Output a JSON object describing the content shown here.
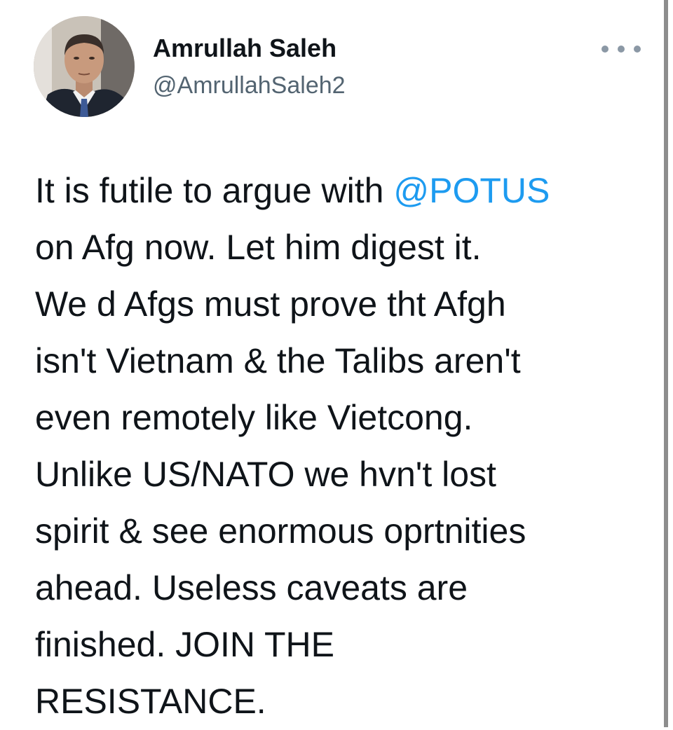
{
  "author": {
    "name": "Amrullah Saleh",
    "handle": "@AmrullahSaleh2",
    "avatar_icon": "profile-photo"
  },
  "menu": {
    "icon": "more-horizontal-icon"
  },
  "tweet": {
    "line1_text": "It is futile to argue with ",
    "mention": "@POTUS",
    "lines": [
      "on Afg now. Let him digest it.",
      "We d Afgs must prove tht Afgh",
      "isn't Vietnam & the Talibs aren't",
      "even remotely like Vietcong.",
      "Unlike US/NATO we hvn't lost",
      "spirit & see enormous oprtnities",
      "ahead. Useless caveats are",
      "finished. JOIN THE",
      "RESISTANCE."
    ]
  },
  "colors": {
    "text": "#0f1419",
    "secondary": "#536471",
    "link": "#1d9bf0",
    "scrollbar": "#8d8d8d"
  }
}
